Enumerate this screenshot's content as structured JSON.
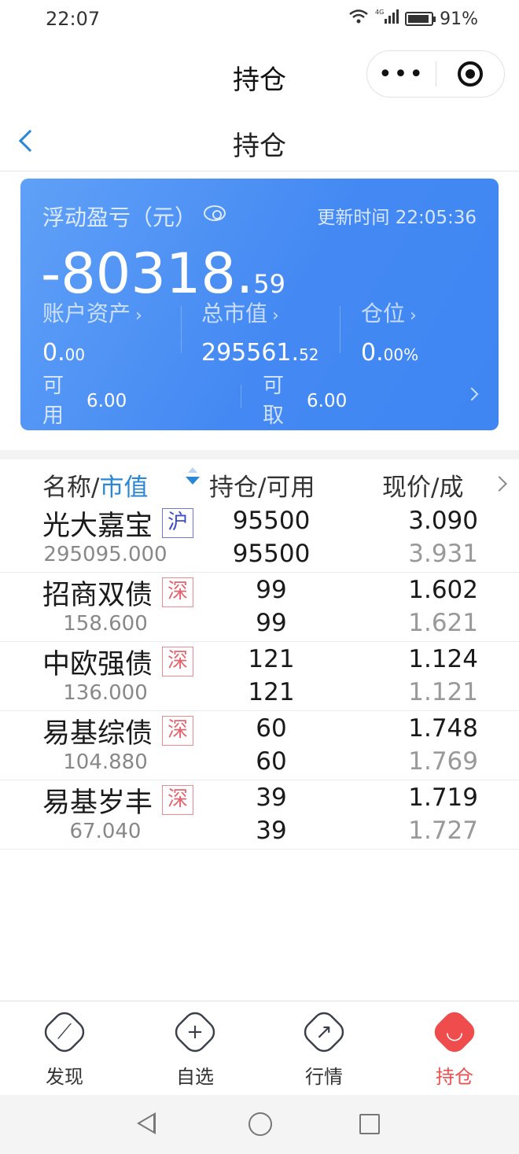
{
  "status_bar": {
    "time": "22:07",
    "network": "4G",
    "battery": "91%",
    "battery_level": 0.91
  },
  "header": {
    "title": "持仓",
    "more_label": "•••"
  },
  "page": {
    "title": "持仓"
  },
  "asset_card": {
    "pl_label": "浮动盈亏（元）",
    "update_time": "更新时间 22:05:36",
    "pl_int": "-80318.",
    "pl_dec": "59",
    "account_assets": {
      "label": "账户资产",
      "int": "0.",
      "dec": "00"
    },
    "market_value": {
      "label": "总市值",
      "int": "295561.",
      "dec": "52"
    },
    "position_ratio": {
      "label": "仓位",
      "int": "0.",
      "dec": "00%"
    },
    "available": {
      "label": "可用",
      "value": "6.00"
    },
    "withdrawable": {
      "label": "可取",
      "value": "6.00"
    },
    "arrow": "›"
  },
  "table": {
    "header": {
      "name": "名称/",
      "market_value": "市值",
      "position": "持仓/可用",
      "price": "现价/成"
    },
    "rows": [
      {
        "name": "光大嘉宝",
        "exchange": "沪",
        "market_value": "295095.000",
        "hold": "95500",
        "avail": "95500",
        "price": "3.090",
        "cost": "3.931"
      },
      {
        "name": "招商双债",
        "exchange": "深",
        "market_value": "158.600",
        "hold": "99",
        "avail": "99",
        "price": "1.602",
        "cost": "1.621"
      },
      {
        "name": "中欧强债",
        "exchange": "深",
        "market_value": "136.000",
        "hold": "121",
        "avail": "121",
        "price": "1.124",
        "cost": "1.121"
      },
      {
        "name": "易基综债",
        "exchange": "深",
        "market_value": "104.880",
        "hold": "60",
        "avail": "60",
        "price": "1.748",
        "cost": "1.769"
      },
      {
        "name": "易基岁丰",
        "exchange": "深",
        "market_value": "67.040",
        "hold": "39",
        "avail": "39",
        "price": "1.719",
        "cost": "1.727"
      }
    ]
  },
  "tabbar": {
    "items": [
      {
        "label": "发现",
        "icon": "compass-icon",
        "glyph": "⟋"
      },
      {
        "label": "自选",
        "icon": "add-icon",
        "glyph": "+"
      },
      {
        "label": "行情",
        "icon": "trend-icon",
        "glyph": "↗"
      },
      {
        "label": "持仓",
        "icon": "smile-icon",
        "glyph": "◡"
      }
    ],
    "active": 3,
    "active_color": "#ef4d4d"
  },
  "colors": {
    "accent": "#2a87d6",
    "card": "#4489f3",
    "sh_badge": "#3b4bc8",
    "sz_badge": "#e6646e"
  }
}
